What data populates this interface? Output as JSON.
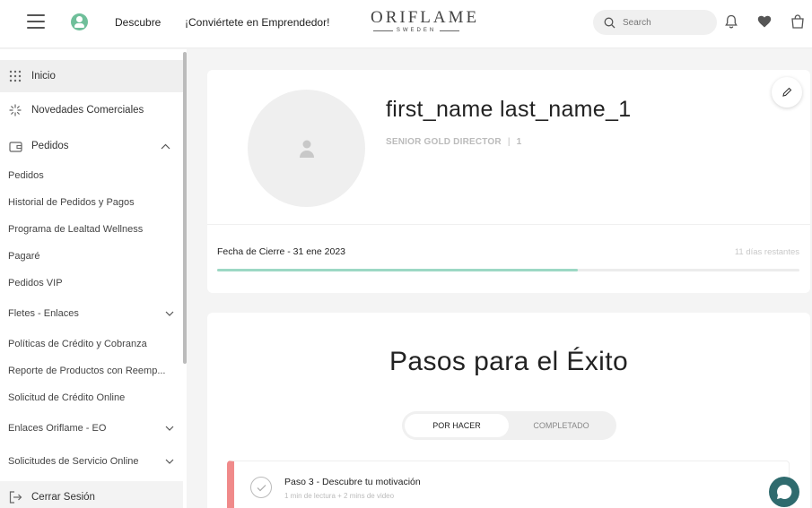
{
  "header": {
    "nav_discover": "Descubre",
    "nav_entrepreneur": "¡Conviértete en Emprendedor!",
    "logo_main": "ORIFLAME",
    "logo_sub": "SWEDEN",
    "search_placeholder": "Search",
    "icons": [
      "menu-icon",
      "user-icon",
      "search-icon",
      "bell-icon",
      "heart-icon",
      "bag-icon"
    ]
  },
  "sidebar": {
    "inicio": "Inicio",
    "novedades": "Novedades Comerciales",
    "pedidos_group": "Pedidos",
    "pedidos_items": [
      "Pedidos",
      "Historial de Pedidos y Pagos",
      "Programa de Lealtad Wellness",
      "Pagaré",
      "Pedidos VIP"
    ],
    "fletes": "Fletes - Enlaces",
    "politicas": "Políticas de Crédito y Cobranza",
    "reporte": "Reporte de Productos con Reemp...",
    "solicitud_credito": "Solicitud de Crédito Online",
    "enlaces_eo": "Enlaces Oriflame - EO",
    "solicitudes_servicio": "Solicitudes de Servicio Online",
    "cerrar_sesion": "Cerrar Sesión"
  },
  "profile": {
    "name": "first_name last_name_1",
    "rank": "SENIOR GOLD DIRECTOR",
    "rank_sep": "|",
    "rank_level": "1",
    "closing_label": "Fecha de Cierre - 31 ene 2023",
    "days_remaining": "11 días restantes",
    "progress_percent": 62
  },
  "steps": {
    "title": "Pasos para el Éxito",
    "tab_todo": "POR HACER",
    "tab_done": "COMPLETADO",
    "step_title": "Paso 3 - Descubre tu motivación",
    "step_meta": "1 min de lectura + 2 mins de video"
  },
  "colors": {
    "accent_green": "#6fbf9a",
    "progress": "#9cd8c4",
    "step_border": "#f08a8a",
    "chat": "#2f6b6e"
  }
}
